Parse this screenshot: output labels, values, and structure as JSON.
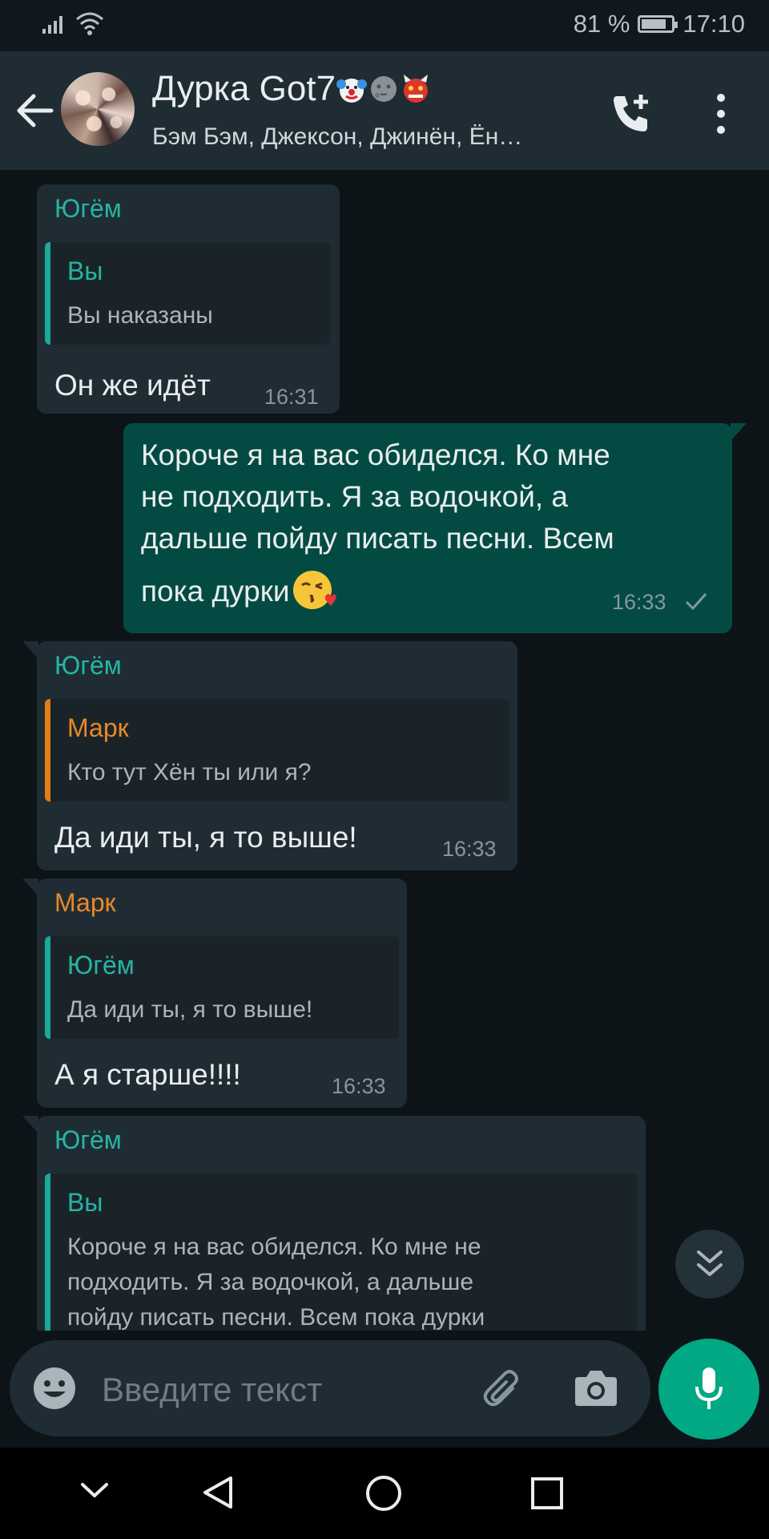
{
  "status_bar": {
    "battery_percent": "81 %",
    "battery_level": 0.81,
    "time": "17:10"
  },
  "header": {
    "title": "Дурка Got7",
    "title_emojis": [
      "clown-face-icon",
      "new-moon-face-icon",
      "ogre-face-icon"
    ],
    "subtitle": "Бэм Бэм, Джексон, Джинён, Ён…"
  },
  "messages": [
    {
      "direction": "in",
      "sender": "Югём",
      "sender_color": "#26b5a5",
      "quote_author": "Вы",
      "quote_text": "Вы наказаны",
      "text": "Он же идёт",
      "time": "16:31"
    },
    {
      "direction": "out",
      "lines": [
        "Короче я на вас обиделся. Ко мне",
        "не подходить. Я за водочкой, а",
        "дальше пойду писать песни. Всем",
        "пока дурки"
      ],
      "trailing_emoji": "face-blowing-kiss-icon",
      "time": "16:33",
      "status": "sent-check-icon"
    },
    {
      "direction": "in",
      "sender": "Югём",
      "sender_color": "#26b5a5",
      "quote_author": "Марк",
      "quote_author_color": "#e8882a",
      "quote_text": "Кто тут Хён ты или я?",
      "text": "Да иди ты,  я то выше!",
      "time": "16:33"
    },
    {
      "direction": "in",
      "sender": "Марк",
      "sender_color": "#e8882a",
      "quote_author": "Югём",
      "quote_text": "Да иди ты,  я то выше!",
      "text": "А я старше!!!!",
      "time": "16:33"
    },
    {
      "direction": "in",
      "sender": "Югём",
      "sender_color": "#26b5a5",
      "quote_author": "Вы",
      "quote_text": "Короче я на вас обиделся. Ко мне не\nподходить. Я за водочкой, а дальше\nпойду писать песни. Всем пока дурки"
    }
  ],
  "input": {
    "placeholder": "Введите текст"
  },
  "colors": {
    "background": "#0d1418",
    "header": "#1f2c34",
    "incoming_bubble": "#202c33",
    "outgoing_bubble": "#034b42",
    "accent": "#00a884"
  }
}
